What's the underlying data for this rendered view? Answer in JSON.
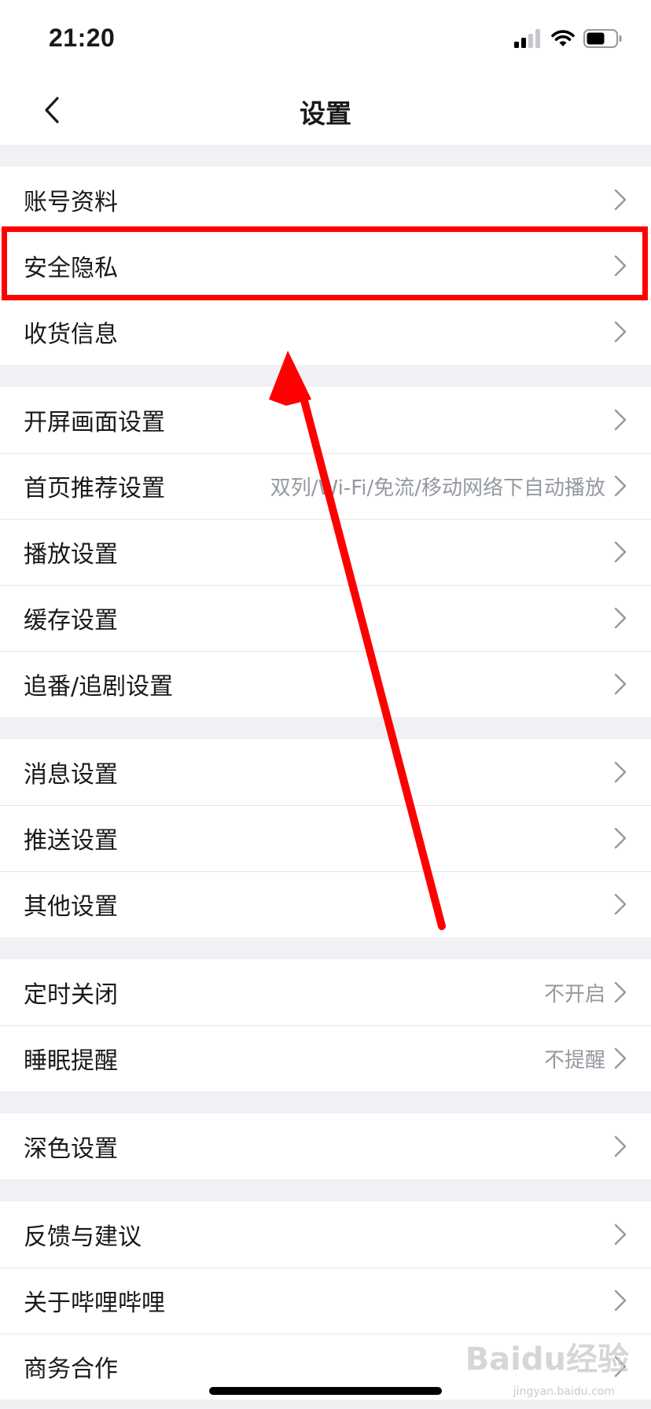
{
  "status_bar": {
    "time": "21:20",
    "icons": [
      "signal-icon",
      "wifi-icon",
      "battery-icon"
    ]
  },
  "header": {
    "title": "设置"
  },
  "colors": {
    "highlight": "#ff0000",
    "arrow": "#ff0000",
    "divider": "#e6e7ea",
    "background": "#f0f1f4",
    "secondary_text": "#9499a0"
  },
  "groups": [
    {
      "items": [
        {
          "label": "账号资料"
        },
        {
          "label": "安全隐私",
          "highlighted": true
        },
        {
          "label": "收货信息"
        }
      ]
    },
    {
      "items": [
        {
          "label": "开屏画面设置"
        },
        {
          "label": "首页推荐设置",
          "value": "双列/Wi-Fi/免流/移动网络下自动播放"
        },
        {
          "label": "播放设置"
        },
        {
          "label": "缓存设置"
        },
        {
          "label": "追番/追剧设置"
        }
      ]
    },
    {
      "items": [
        {
          "label": "消息设置"
        },
        {
          "label": "推送设置"
        },
        {
          "label": "其他设置"
        }
      ]
    },
    {
      "items": [
        {
          "label": "定时关闭",
          "value": "不开启"
        },
        {
          "label": "睡眠提醒",
          "value": "不提醒"
        }
      ]
    },
    {
      "items": [
        {
          "label": "深色设置"
        }
      ]
    },
    {
      "items": [
        {
          "label": "反馈与建议"
        },
        {
          "label": "关于哔哩哔哩"
        },
        {
          "label": "商务合作"
        }
      ]
    }
  ],
  "watermark": {
    "text": "Baidu经验",
    "sub": "jingyan.baidu.com"
  }
}
